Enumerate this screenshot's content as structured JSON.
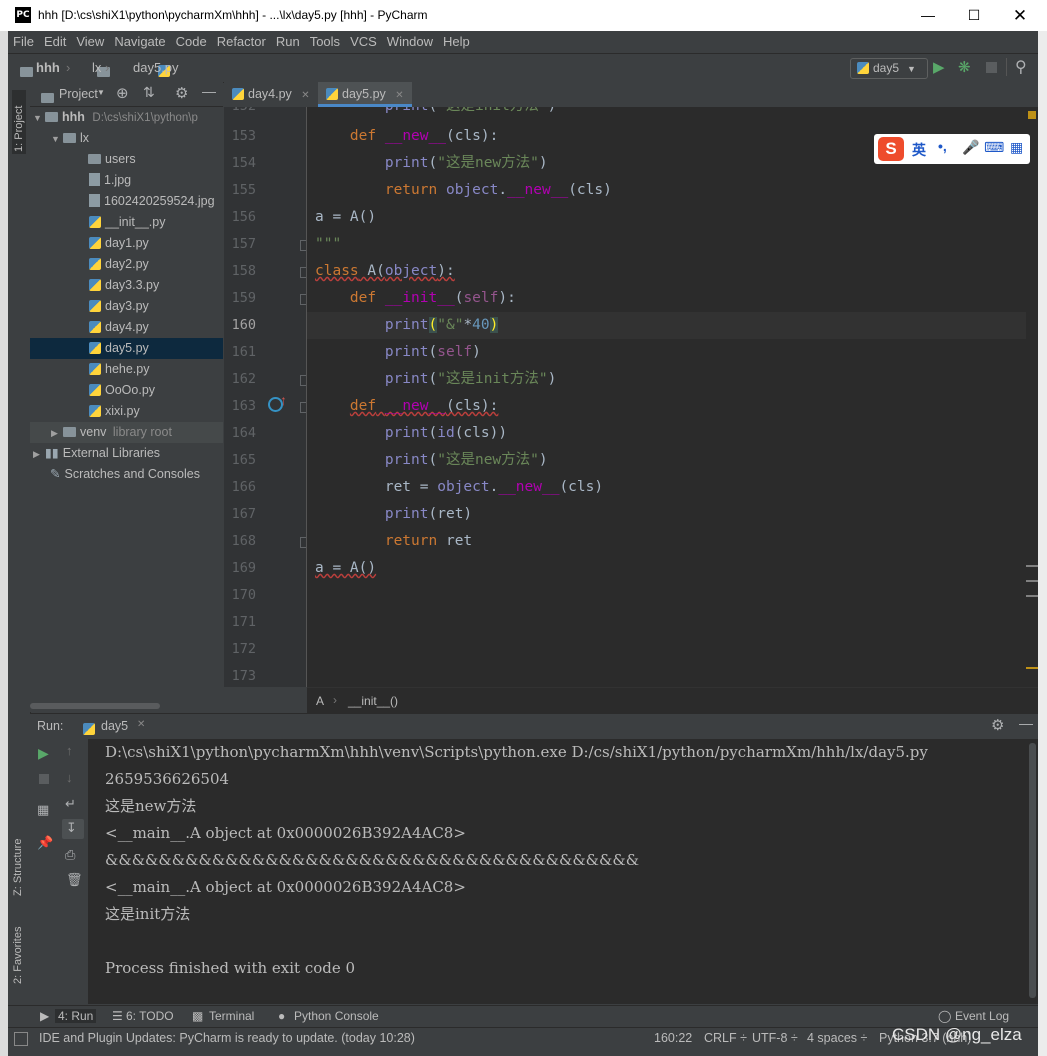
{
  "window": {
    "title": "hhh [D:\\cs\\shiX1\\python\\pycharmXm\\hhh] - ...\\lx\\day5.py [hhh] - PyCharm",
    "logo": "PC"
  },
  "menu": [
    "File",
    "Edit",
    "View",
    "Navigate",
    "Code",
    "Refactor",
    "Run",
    "Tools",
    "VCS",
    "Window",
    "Help"
  ],
  "nav": {
    "crumbs": [
      "hhh",
      "lx",
      "day5.py"
    ],
    "run_config": "day5"
  },
  "left_stripe": {
    "project": "1: Project",
    "structure": "Z: Structure",
    "favorites": "2: Favorites"
  },
  "project": {
    "header": "Project",
    "root_name": "hhh",
    "root_path": "D:\\cs\\shiX1\\python\\p",
    "items": [
      {
        "label": "lx",
        "type": "folder"
      },
      {
        "label": "users",
        "type": "folder"
      },
      {
        "label": "1.jpg",
        "type": "image"
      },
      {
        "label": "1602420259524.jpg",
        "type": "image"
      },
      {
        "label": "__init__.py",
        "type": "py"
      },
      {
        "label": "day1.py",
        "type": "py"
      },
      {
        "label": "day2.py",
        "type": "py"
      },
      {
        "label": "day3.3.py",
        "type": "py"
      },
      {
        "label": "day3.py",
        "type": "py"
      },
      {
        "label": "day4.py",
        "type": "py"
      },
      {
        "label": "day5.py",
        "type": "py"
      },
      {
        "label": "hehe.py",
        "type": "py"
      },
      {
        "label": "OoOo.py",
        "type": "py"
      },
      {
        "label": "xixi.py",
        "type": "py"
      }
    ],
    "venv": "venv",
    "venv_note": "library root",
    "external": "External Libraries",
    "scratches": "Scratches and Consoles"
  },
  "tabs": [
    {
      "label": "day4.py",
      "active": false
    },
    {
      "label": "day5.py",
      "active": true
    }
  ],
  "editor": {
    "current_line": "160",
    "line_numbers": [
      "152",
      "153",
      "154",
      "155",
      "156",
      "157",
      "158",
      "159",
      "160",
      "161",
      "162",
      "163",
      "164",
      "165",
      "166",
      "167",
      "168",
      "169",
      "170",
      "171",
      "172",
      "173"
    ],
    "breadcrumb": [
      "A",
      "__init__()"
    ]
  },
  "ime": {
    "lang": "英",
    "punct": "•,"
  },
  "run": {
    "label": "Run:",
    "tab": "day5",
    "output": [
      "D:\\cs\\shiX1\\python\\pycharmXm\\hhh\\venv\\Scripts\\python.exe D:/cs/shiX1/python/pycharmXm/hhh/lx/day5.py",
      "2659536626504",
      "这是new方法",
      "<__main__.A object at 0x0000026B392A4AC8>",
      "&&&&&&&&&&&&&&&&&&&&&&&&&&&&&&&&&&&&&&&&",
      "<__main__.A object at 0x0000026B392A4AC8>",
      "这是init方法",
      "",
      "Process finished with exit code 0"
    ]
  },
  "bottom_tabs": {
    "run": "4: Run",
    "todo": "6: TODO",
    "terminal": "Terminal",
    "python_console": "Python Console",
    "event_log": "Event Log"
  },
  "status": {
    "message": "IDE and Plugin Updates: PyCharm is ready to update. (today 10:28)",
    "position": "160:22",
    "line_sep": "CRLF ÷",
    "encoding": "UTF-8 ÷",
    "indent": "4 spaces ÷",
    "interpreter": "Python 3.7 (hhh)",
    "watermark": "CSDN @ng_elza"
  }
}
